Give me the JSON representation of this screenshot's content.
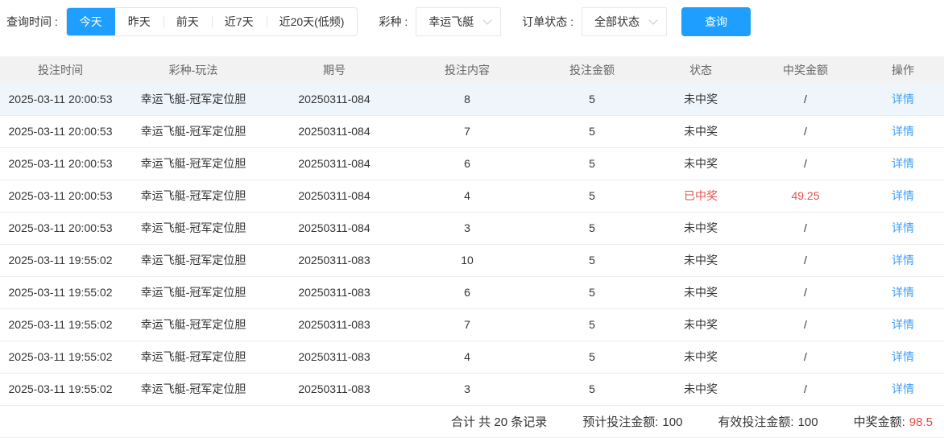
{
  "toolbar": {
    "time_label": "查询时间 :",
    "time_options": [
      {
        "label": "今天",
        "active": true
      },
      {
        "label": "昨天",
        "active": false
      },
      {
        "label": "前天",
        "active": false
      },
      {
        "label": "近7天",
        "active": false
      },
      {
        "label": "近20天(低频)",
        "active": false
      }
    ],
    "lottery_label": "彩种 :",
    "lottery_value": "幸运飞艇",
    "status_label": "订单状态 :",
    "status_value": "全部状态",
    "search_label": "查询"
  },
  "table": {
    "columns": [
      "投注时间",
      "彩种-玩法",
      "期号",
      "投注内容",
      "投注金额",
      "状态",
      "中奖金额",
      "操作"
    ],
    "detail_label": "详情",
    "rows": [
      {
        "time": "2025-03-11 20:00:53",
        "game": "幸运飞艇-冠军定位胆",
        "issue": "20250311-084",
        "content": "8",
        "amount": "5",
        "status": "未中奖",
        "prize": "/",
        "won": false,
        "highlight": true
      },
      {
        "time": "2025-03-11 20:00:53",
        "game": "幸运飞艇-冠军定位胆",
        "issue": "20250311-084",
        "content": "7",
        "amount": "5",
        "status": "未中奖",
        "prize": "/",
        "won": false,
        "highlight": false
      },
      {
        "time": "2025-03-11 20:00:53",
        "game": "幸运飞艇-冠军定位胆",
        "issue": "20250311-084",
        "content": "6",
        "amount": "5",
        "status": "未中奖",
        "prize": "/",
        "won": false,
        "highlight": false
      },
      {
        "time": "2025-03-11 20:00:53",
        "game": "幸运飞艇-冠军定位胆",
        "issue": "20250311-084",
        "content": "4",
        "amount": "5",
        "status": "已中奖",
        "prize": "49.25",
        "won": true,
        "highlight": false
      },
      {
        "time": "2025-03-11 20:00:53",
        "game": "幸运飞艇-冠军定位胆",
        "issue": "20250311-084",
        "content": "3",
        "amount": "5",
        "status": "未中奖",
        "prize": "/",
        "won": false,
        "highlight": false
      },
      {
        "time": "2025-03-11 19:55:02",
        "game": "幸运飞艇-冠军定位胆",
        "issue": "20250311-083",
        "content": "10",
        "amount": "5",
        "status": "未中奖",
        "prize": "/",
        "won": false,
        "highlight": false
      },
      {
        "time": "2025-03-11 19:55:02",
        "game": "幸运飞艇-冠军定位胆",
        "issue": "20250311-083",
        "content": "6",
        "amount": "5",
        "status": "未中奖",
        "prize": "/",
        "won": false,
        "highlight": false
      },
      {
        "time": "2025-03-11 19:55:02",
        "game": "幸运飞艇-冠军定位胆",
        "issue": "20250311-083",
        "content": "7",
        "amount": "5",
        "status": "未中奖",
        "prize": "/",
        "won": false,
        "highlight": false
      },
      {
        "time": "2025-03-11 19:55:02",
        "game": "幸运飞艇-冠军定位胆",
        "issue": "20250311-083",
        "content": "4",
        "amount": "5",
        "status": "未中奖",
        "prize": "/",
        "won": false,
        "highlight": false
      },
      {
        "time": "2025-03-11 19:55:02",
        "game": "幸运飞艇-冠军定位胆",
        "issue": "20250311-083",
        "content": "3",
        "amount": "5",
        "status": "未中奖",
        "prize": "/",
        "won": false,
        "highlight": false
      }
    ]
  },
  "footer": {
    "total_label": "合计 共 20 条记录",
    "expected_label": "预计投注金额:",
    "expected_value": "100",
    "valid_label": "有效投注金额:",
    "valid_value": "100",
    "prize_label": "中奖金额:",
    "prize_value": "98.5"
  },
  "colors": {
    "accent": "#1e9fff",
    "link": "#3e9ef7",
    "win_red": "#e5504a",
    "header_bg": "#f2f2f2",
    "row_highlight": "#eef6fc",
    "border": "#ebebeb"
  }
}
